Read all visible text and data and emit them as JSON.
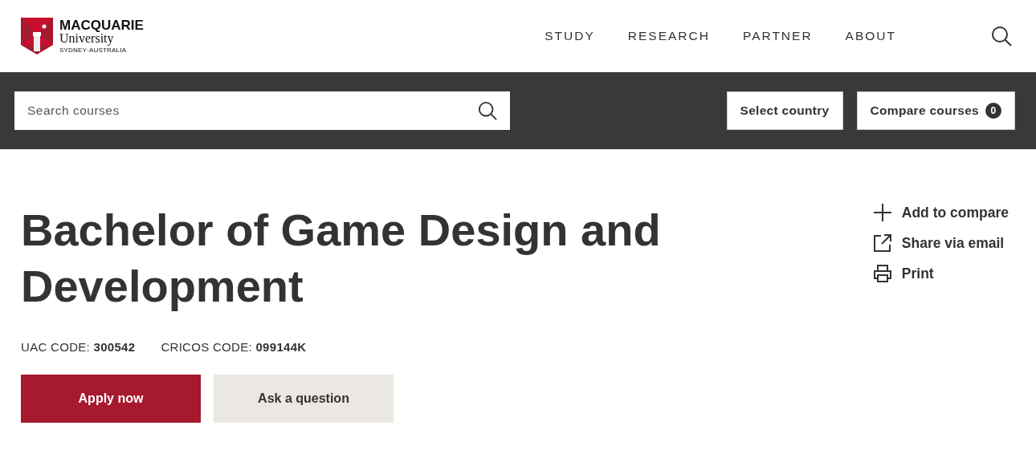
{
  "header": {
    "logo": {
      "name": "MACQUARIE",
      "sub": "University",
      "tagline": "SYDNEY·AUSTRALIA"
    },
    "nav": [
      {
        "label": "STUDY"
      },
      {
        "label": "RESEARCH"
      },
      {
        "label": "PARTNER"
      },
      {
        "label": "ABOUT"
      }
    ]
  },
  "search_bar": {
    "placeholder": "Search courses",
    "buttons": [
      {
        "kind": "plain",
        "label": "Select country"
      },
      {
        "kind": "count",
        "label": "Compare courses",
        "count": "0"
      }
    ]
  },
  "course": {
    "title": "Bachelor of Game Design and Development",
    "codes": [
      "UAC CODE: **300542**",
      "CRICOS CODE: **099144K**"
    ],
    "buttons": [
      {
        "kind": "primary",
        "label": "Apply now"
      },
      {
        "kind": "secondary",
        "label": "Ask a question"
      }
    ],
    "actions": [
      {
        "kind": "plus",
        "label": "Add to compare"
      },
      {
        "kind": "share",
        "label": "Share via email"
      },
      {
        "kind": "print",
        "label": "Print"
      }
    ]
  }
}
